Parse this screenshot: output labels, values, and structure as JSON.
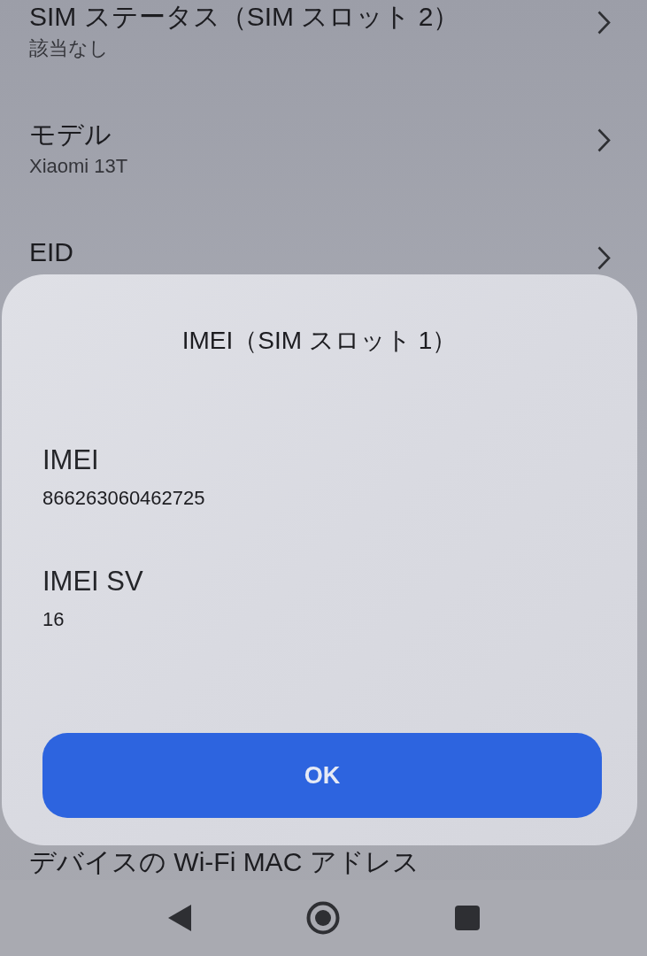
{
  "settings_list": [
    {
      "title": "SIM ステータス（SIM スロット 2）",
      "subtitle": "該当なし",
      "chevron": true
    },
    {
      "title": "モデル",
      "subtitle": "Xiaomi 13T",
      "chevron": true
    },
    {
      "title": "EID",
      "chevron": true
    }
  ],
  "bottom_row": {
    "title": "デバイスの Wi-Fi MAC アドレス"
  },
  "dialog": {
    "title": "IMEI（SIM スロット 1）",
    "fields": [
      {
        "label": "IMEI",
        "value": "866263060462725"
      },
      {
        "label": "IMEI SV",
        "value": "16"
      }
    ],
    "button": "OK"
  }
}
